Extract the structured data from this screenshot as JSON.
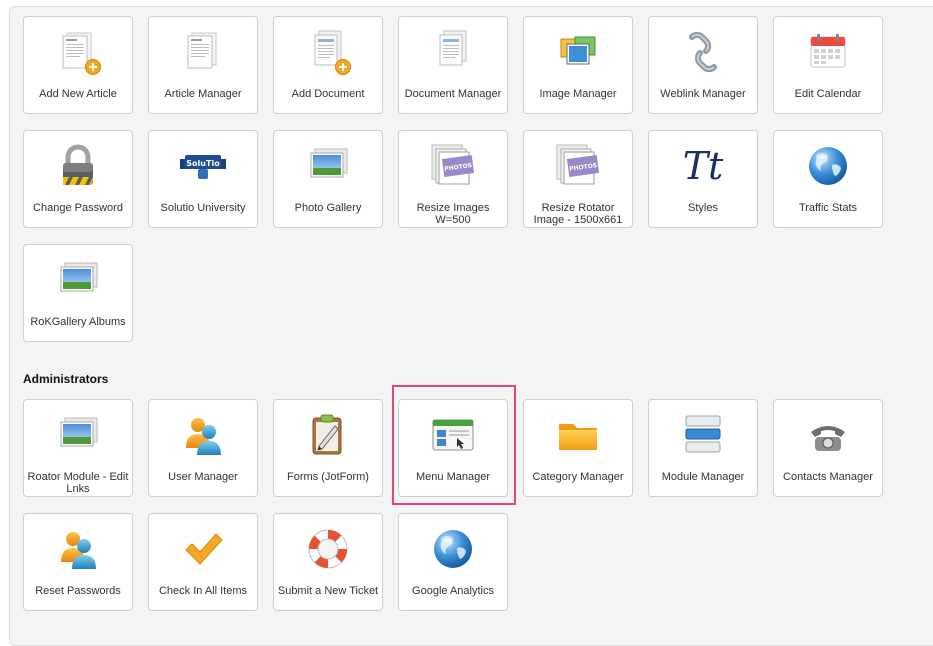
{
  "content_tiles": [
    {
      "label": "Add New Article",
      "icon": "add-article-icon"
    },
    {
      "label": "Article Manager",
      "icon": "article-icon"
    },
    {
      "label": "Add Document",
      "icon": "add-document-icon"
    },
    {
      "label": "Document Manager",
      "icon": "document-icon"
    },
    {
      "label": "Image Manager",
      "icon": "image-icon"
    },
    {
      "label": "Weblink Manager",
      "icon": "chain-link-icon"
    },
    {
      "label": "Edit Calendar",
      "icon": "calendar-icon"
    },
    {
      "label": "Change Password",
      "icon": "padlock-icon"
    },
    {
      "label": "Solutio University",
      "icon": "solutio-university-logo"
    },
    {
      "label": "Photo Gallery",
      "icon": "photo-gallery-icon"
    },
    {
      "label": "Resize Images W=500",
      "icon": "resize-photos-icon"
    },
    {
      "label": "Resize Rotator Image - 1500x661",
      "icon": "resize-photos-icon"
    },
    {
      "label": "Styles",
      "icon": "styles-tt-icon"
    },
    {
      "label": "Traffic Stats",
      "icon": "globe-icon"
    },
    {
      "label": "RoKGallery Albums",
      "icon": "photo-gallery-icon"
    }
  ],
  "logo_text": {
    "solutio": "SoluTio"
  },
  "styles_glyph": "Tt",
  "admin_section": {
    "title": "Administrators"
  },
  "admin_tiles": [
    {
      "label": "Roator Module - Edit Lnks",
      "icon": "photo-gallery-icon"
    },
    {
      "label": "User Manager",
      "icon": "users-icon"
    },
    {
      "label": "Forms (JotForm)",
      "icon": "clipboard-pen-icon"
    },
    {
      "label": "Menu Manager",
      "icon": "menu-window-icon",
      "highlighted": true
    },
    {
      "label": "Category Manager",
      "icon": "folder-icon"
    },
    {
      "label": "Module Manager",
      "icon": "module-stack-icon"
    },
    {
      "label": "Contacts Manager",
      "icon": "telephone-icon"
    },
    {
      "label": "Reset Passwords",
      "icon": "users-icon"
    },
    {
      "label": "Check In All Items",
      "icon": "checkmark-icon"
    },
    {
      "label": "Submit a New Ticket",
      "icon": "lifebuoy-icon"
    },
    {
      "label": "Google Analytics",
      "icon": "globe-icon"
    }
  ],
  "colors": {
    "highlight": "#e8437f",
    "tile_border": "#cfcfcf",
    "panel_bg": "#f4f4f4"
  }
}
